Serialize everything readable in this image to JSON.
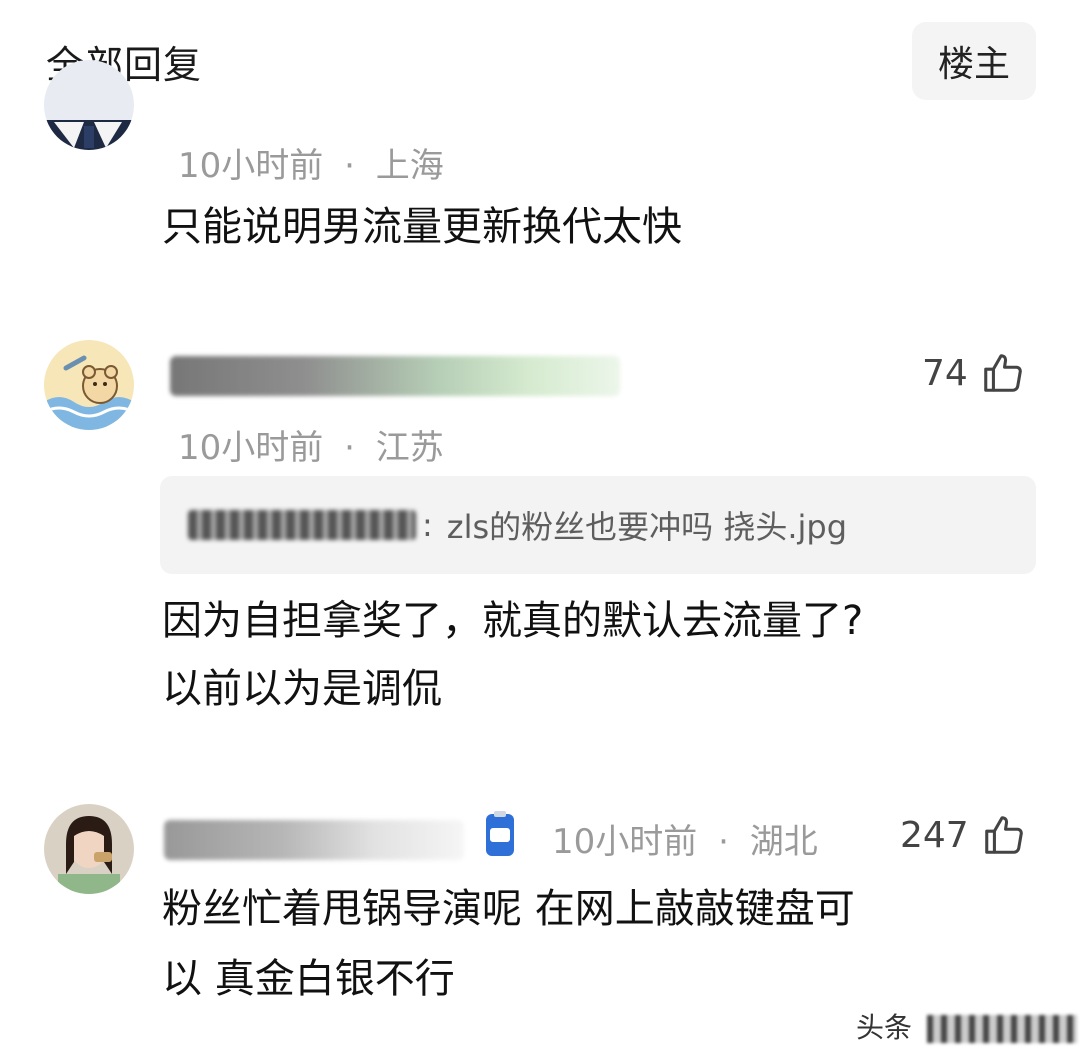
{
  "header": {
    "title": "全部回复",
    "op_button_label": "楼主"
  },
  "comments": [
    {
      "time": "10小时前",
      "location": "上海",
      "content": "只能说明男流量更新换代太快"
    },
    {
      "time": "10小时前",
      "location": "江苏",
      "likes": "74",
      "quote_text": "zls的粉丝也要冲吗 挠头.jpg",
      "content_lines": [
        "因为自担拿奖了，就真的默认去流量了?",
        "以前以为是调侃"
      ]
    },
    {
      "time": "10小时前",
      "location": "湖北",
      "likes": "247",
      "content_lines": [
        "粉丝忙着甩锅导演呢 在网上敲敲键盘可",
        "以 真金白银不行"
      ]
    }
  ],
  "separator": "·",
  "watermark": {
    "prefix": "头条"
  },
  "colors": {
    "meta_gray": "#9a9a9a",
    "quote_bg": "#f3f3f3",
    "op_button_bg": "#f4f4f4"
  }
}
